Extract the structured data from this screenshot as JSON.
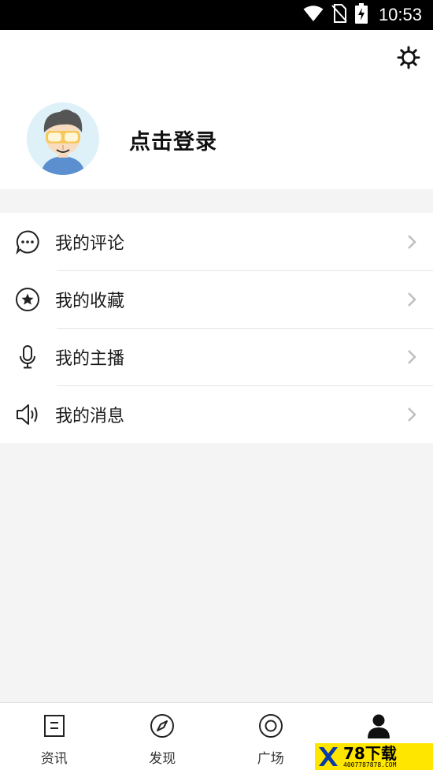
{
  "status_bar": {
    "time": "10:53",
    "icons": [
      "wifi-icon",
      "no-sim-icon",
      "battery-charging-icon"
    ]
  },
  "header": {
    "settings_icon": "gear-icon",
    "login_label": "点击登录",
    "avatar_icon": "user-avatar"
  },
  "menu": {
    "items": [
      {
        "label": "我的评论",
        "icon": "comment-icon"
      },
      {
        "label": "我的收藏",
        "icon": "star-icon"
      },
      {
        "label": "我的主播",
        "icon": "microphone-icon"
      },
      {
        "label": "我的消息",
        "icon": "speaker-icon"
      }
    ]
  },
  "bottom_nav": {
    "tabs": [
      {
        "label": "资讯",
        "icon": "news-icon",
        "active": false
      },
      {
        "label": "发现",
        "icon": "compass-icon",
        "active": false
      },
      {
        "label": "广场",
        "icon": "target-icon",
        "active": false
      },
      {
        "label": "",
        "icon": "person-icon",
        "active": true
      }
    ]
  },
  "watermark": {
    "title": "78下载",
    "subtitle": "4007787878.COM"
  },
  "colors": {
    "status_bar": "#000000",
    "page_background": "#f4f4f4",
    "watermark": "#ffe600"
  }
}
